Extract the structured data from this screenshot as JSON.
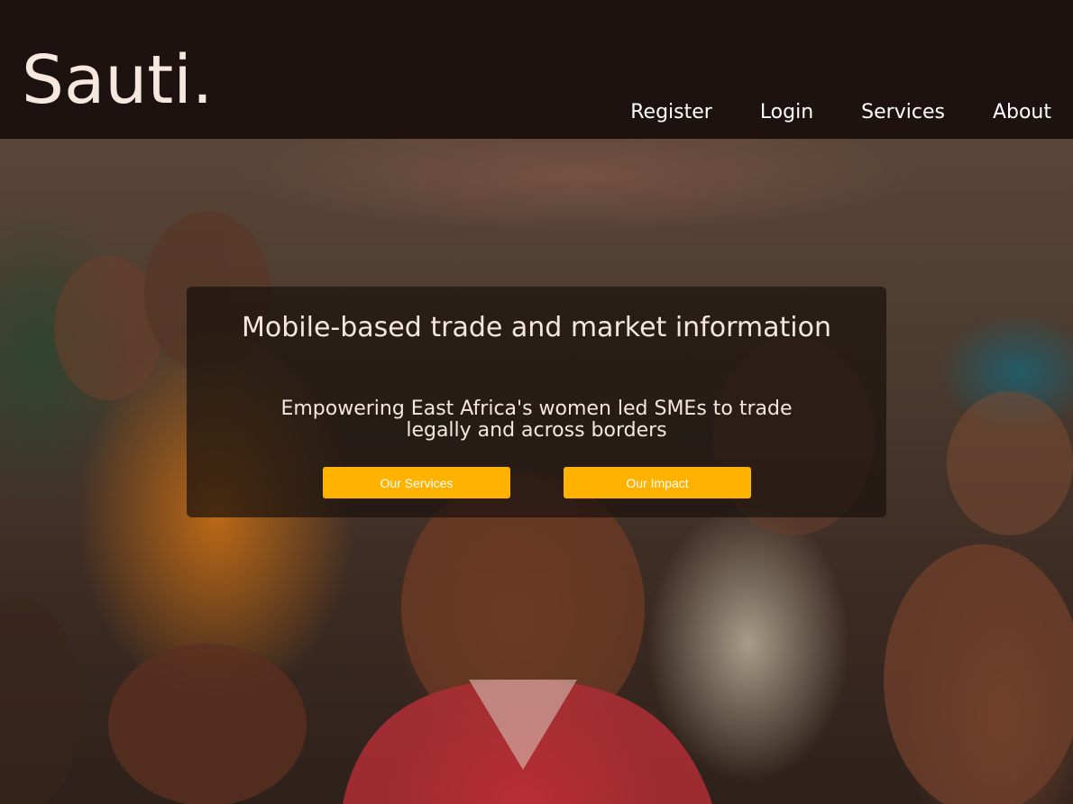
{
  "brand": {
    "logo_text": "Sauti."
  },
  "nav": {
    "items": [
      {
        "label": "Register"
      },
      {
        "label": "Login"
      },
      {
        "label": "Services"
      },
      {
        "label": "About"
      }
    ]
  },
  "hero": {
    "headline": "Mobile-based trade and market information",
    "subheadline": "Empowering East Africa's women led SMEs to trade legally and across borders",
    "buttons": {
      "services_label": "Our Services",
      "impact_label": "Our Impact"
    }
  },
  "colors": {
    "header_bg": "#1e1211",
    "logo": "#f6e7df",
    "accent_button": "#ffb200",
    "overlay_bg": "rgba(26,18,14,0.72)"
  }
}
